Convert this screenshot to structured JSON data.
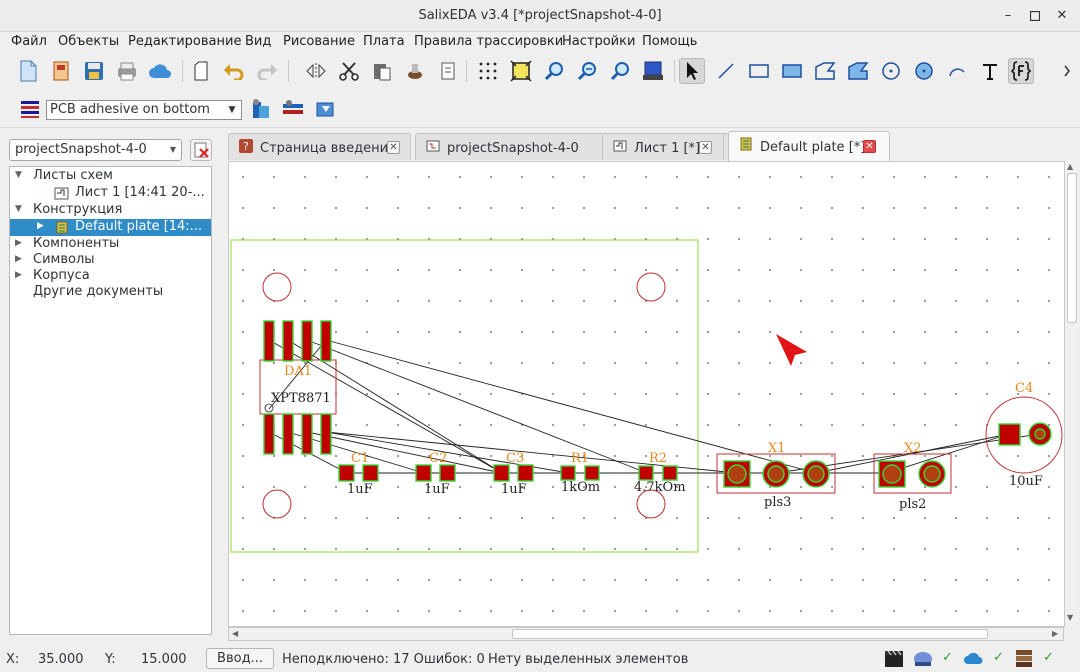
{
  "window": {
    "title": "SalixEDA v3.4 [*projectSnapshot-4-0]"
  },
  "menu": [
    "Файл",
    "Объекты",
    "Редактирование",
    "Вид",
    "Рисование",
    "Плата",
    "Правила трассировки",
    "Настройки",
    "Помощь"
  ],
  "toolbar2": {
    "layer": "PCB adhesive on bottom"
  },
  "project": {
    "selected": "projectSnapshot-4-0"
  },
  "tree": {
    "sheets": "Листы схем",
    "sheet1": "Лист 1 [14:41 20-...",
    "construction": "Конструкция",
    "plate": "Default plate [14:...",
    "components": "Компоненты",
    "symbols": "Символы",
    "packages": "Корпуса",
    "other": "Другие документы"
  },
  "tabs": [
    "Страница введения",
    "projectSnapshot-4-0",
    "Лист 1 [*]",
    "Default plate [*]"
  ],
  "pcb": {
    "components": {
      "DA1": {
        "ref": "DA1",
        "value": "XPT8871"
      },
      "C1": {
        "ref": "C1",
        "value": "1uF"
      },
      "C2": {
        "ref": "C2",
        "value": "1uF"
      },
      "C3": {
        "ref": "C3",
        "value": "1uF"
      },
      "R1": {
        "ref": "R1",
        "value": "1kOm"
      },
      "R2": {
        "ref": "R2",
        "value": "4.7kOm"
      },
      "X1": {
        "ref": "X1",
        "value": "pls3"
      },
      "X2": {
        "ref": "X2",
        "value": "pls2"
      },
      "C4": {
        "ref": "C4",
        "value": "10uF"
      }
    },
    "colors": {
      "pad": "#c00000",
      "pad_outline": "#36d936",
      "outline": "#9ee04f",
      "label": "#e08a1e",
      "silk": "#c03030"
    }
  },
  "status": {
    "x_label": "X:",
    "x_value": "35.000",
    "y_label": "Y:",
    "y_value": "15.000",
    "enter_button": "Ввод...",
    "unconnected": "Неподключено: 17 Ошибок: 0",
    "selection": "Нету выделенных элементов"
  }
}
